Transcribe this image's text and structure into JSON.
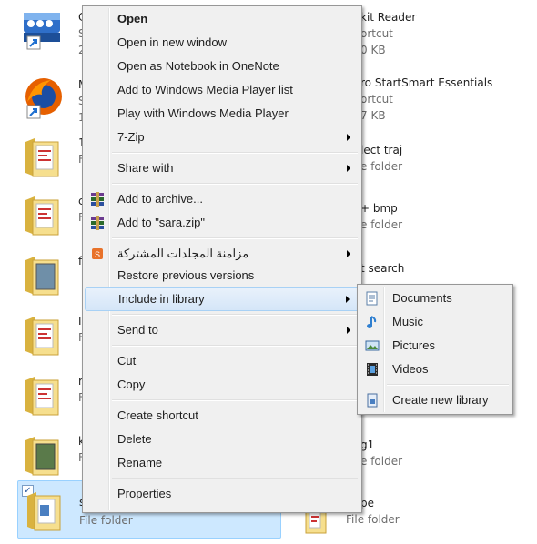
{
  "files": {
    "left": [
      {
        "name": "C",
        "type": "S",
        "size": "2"
      },
      {
        "name": "M",
        "type": "S",
        "size": "1"
      },
      {
        "name": "1",
        "type": "F",
        "size": ""
      },
      {
        "name": "c",
        "type": "F",
        "size": ""
      },
      {
        "name": "f",
        "type": "F",
        "size": ""
      },
      {
        "name": "I",
        "type": "F",
        "size": ""
      },
      {
        "name": "r",
        "type": "F",
        "size": ""
      },
      {
        "name": "k",
        "type": "F",
        "size": ""
      },
      {
        "name": "s",
        "type": "File folder",
        "size": ""
      }
    ],
    "right": [
      {
        "name": "kit Reader",
        "type": "ortcut",
        "size": "0 KB"
      },
      {
        "name": "ro StartSmart Essentials",
        "type": "ortcut",
        "size": "7 KB"
      },
      {
        "name": "lect traj",
        "type": "e folder",
        "size": ""
      },
      {
        "name": "+ bmp",
        "type": "e folder",
        "size": ""
      },
      {
        "name": "t search",
        "type": "",
        "size": ""
      },
      {
        "name": "",
        "type": "",
        "size": ""
      },
      {
        "name": "",
        "type": "",
        "size": ""
      },
      {
        "name": "g1",
        "type": "e folder",
        "size": ""
      },
      {
        "name": "pe",
        "type": "File folder",
        "size": ""
      }
    ]
  },
  "context_menu": {
    "open": "Open",
    "open_new_window": "Open in new window",
    "open_onenote": "Open as Notebook in OneNote",
    "add_wmp_list": "Add to Windows Media Player list",
    "play_wmp": "Play with Windows Media Player",
    "seven_zip": "7-Zip",
    "share_with": "Share with",
    "add_archive": "Add to archive...",
    "add_sara_zip": "Add to \"sara.zip\"",
    "sync_shared": "مزامنة المجلدات المشتركة",
    "restore_versions": "Restore previous versions",
    "include_library": "Include in library",
    "send_to": "Send to",
    "cut": "Cut",
    "copy": "Copy",
    "create_shortcut": "Create shortcut",
    "delete": "Delete",
    "rename": "Rename",
    "properties": "Properties"
  },
  "library_submenu": {
    "documents": "Documents",
    "music": "Music",
    "pictures": "Pictures",
    "videos": "Videos",
    "create_new": "Create new library"
  },
  "colors": {
    "menu_bg": "#f0f0f0",
    "highlight": "#d5e6f8",
    "selection": "#cde8ff"
  }
}
